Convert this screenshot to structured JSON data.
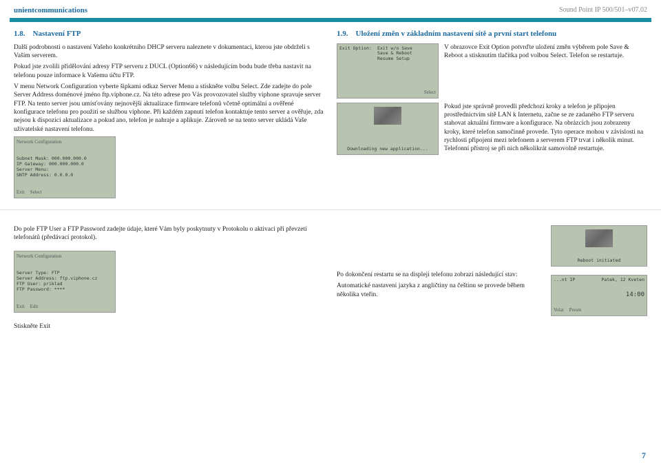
{
  "header": {
    "logo_bold": "unient",
    "logo_light": "communications",
    "right_title": "Sound Point IP 500/501–v07.02"
  },
  "left": {
    "section_no": "1.8.",
    "section_title": "Nastavení FTP",
    "p1": "Další podrobnosti o nastavení Vašeho konkrétního DHCP serveru naleznete v dokumentaci, kterou jste obdrželi s Vaším serverem.",
    "p2": "Pokud jste zvolili přidělování adresy FTP serveru z DUCL (Option66) v následujícím bodu bude třeba nastavit na telefonu pouze informace k Vašemu účtu FTP.",
    "p3": "V menu Network Configuration vyberte šipkami odkaz Server Menu a stiskněte volbu Select. Zde zadejte do pole Server Address doménové jméno ftp.viphone.cz. Na této adrese pro Vás provozovatel služby viphone spravuje server FTP. Na tento server jsou umísťovány nejnovější aktualizace firmware telefonů včetně optimální a ověřené konfigurace telefonu pro použití se službou viphone. Při každém zapnutí telefon kontaktuje tento server a ověřuje, zda nejsou k dispozici aktualizace a pokud ano, telefon je nahraje a aplikuje. Zároveň se na tento server ukládá Vaše uživatelské nastavení telefonu."
  },
  "lcd1": {
    "title": "Network Configuration",
    "l1": "Subnet Mask:  000.000.000.0",
    "l2": "IP Gateway:   000.000.000.0",
    "l3": "Server Menu:",
    "l4": "SNTP Address: 0.0.0.0",
    "btn1": "Exit",
    "btn2": "Select"
  },
  "right": {
    "section_no": "1.9.",
    "section_title": "Uložení změn v základním nastavení sítě a první start telefonu",
    "p1": "V obrazovce Exit Option potvrďte uložení změn výběrem pole Save & Reboot a stisknutím tlačítka pod volbou Select. Telefon se restartuje.",
    "p2": "Pokud jste správně provedli předchozí kroky a telefon je připojen prostřednictvím sítě LAN k Internetu, začne se ze zadaného FTP serveru stahovat aktuální firmware a konfigurace. Na obrázcích jsou zobrazeny kroky, které telefon samočinně provede. Tyto operace mohou v závislosti na rychlosti připojení mezi telefonem a serverem FTP trvat i několik minut. Telefonní přístroj se při nich několikrát samovolně restartuje."
  },
  "lcd2": {
    "l1": "Exit Option:",
    "l2": "Exit w/o Save",
    "l3": "Save & Reboot",
    "l4": "Resume Setup",
    "btn1": "Select"
  },
  "lcd3": {
    "l1": "Downloading new application..."
  },
  "bottom": {
    "p1": "Do pole FTP User a FTP Password zadejte údaje, které Vám byly poskytnuty v Protokolu o aktivaci při převzetí telefonátů (předávací protokol).",
    "p2": "Stiskněte Exit"
  },
  "lcd4": {
    "title": "Network Configuration",
    "l1": "Server Type:    FTP",
    "l2": "Server Address: ftp.viphone.cz",
    "l3": "FTP User:       priklad",
    "l4": "FTP Password:   ****",
    "btn1": "Exit",
    "btn2": "Edit"
  },
  "lcd5": {
    "l1": "Reboot initiated"
  },
  "lcd6": {
    "top_right": "Patek, 12 Kveten",
    "time": "14:00",
    "left": "...nt IP",
    "btn1": "Volat",
    "btn2": "Presm"
  },
  "bottom_right": {
    "p1": "Po dokončení restartu se na displeji telefonu zobrazí následující stav:",
    "p2": "Automatické nastavení jazyka z angličtiny na češtinu se provede během několika vteřin."
  },
  "page_number": "7"
}
